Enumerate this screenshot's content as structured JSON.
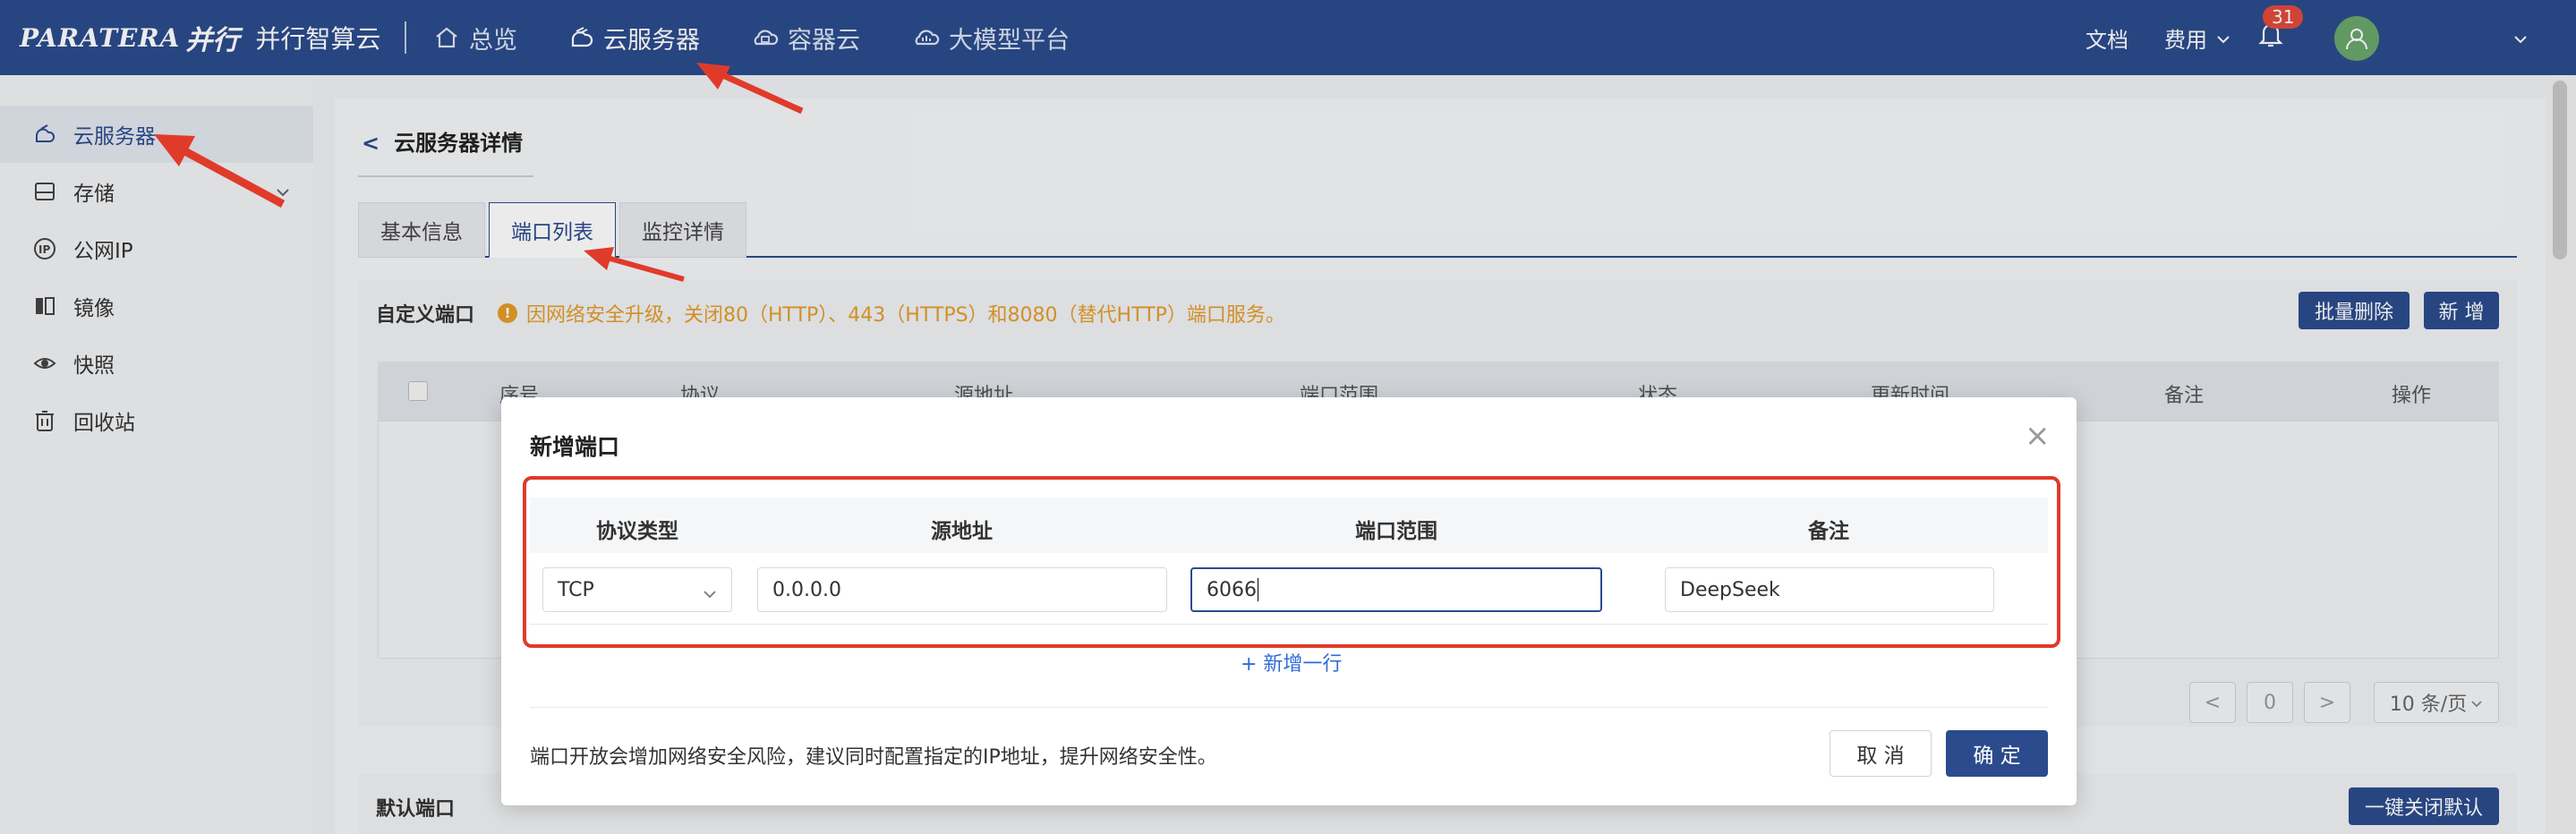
{
  "brand": {
    "name": "PARATERA",
    "cn": "并行",
    "subtitle": "并行智算云"
  },
  "topnav": [
    {
      "label": "总览",
      "icon": "home-icon"
    },
    {
      "label": "云服务器",
      "icon": "cloud-server-icon",
      "active": true
    },
    {
      "label": "容器云",
      "icon": "container-cloud-icon"
    },
    {
      "label": "大模型平台",
      "icon": "model-platform-icon"
    }
  ],
  "topright": {
    "docs": "文档",
    "fees": "费用",
    "notifications": "31"
  },
  "sidebar": {
    "items": [
      {
        "label": "云服务器",
        "icon": "cloud-server-icon",
        "active": true
      },
      {
        "label": "存储",
        "icon": "storage-icon",
        "expandable": true
      },
      {
        "label": "公网IP",
        "icon": "ip-icon"
      },
      {
        "label": "镜像",
        "icon": "image-icon"
      },
      {
        "label": "快照",
        "icon": "snapshot-icon"
      },
      {
        "label": "回收站",
        "icon": "recycle-bin-icon"
      }
    ]
  },
  "page": {
    "back": "<",
    "title": "云服务器详情",
    "tabs": [
      {
        "label": "基本信息"
      },
      {
        "label": "端口列表",
        "active": true
      },
      {
        "label": "监控详情"
      }
    ]
  },
  "custom_ports": {
    "title": "自定义端口",
    "notice": "因网络安全升级，关闭80（HTTP）、443（HTTPS）和8080（替代HTTP）端口服务。",
    "btn_batch_delete": "批量删除",
    "btn_add": "新 增",
    "columns": [
      "序号",
      "协议",
      "源地址",
      "端口范围",
      "状态",
      "更新时间",
      "备注",
      "操作"
    ],
    "pager": {
      "prev": "<",
      "page": "0",
      "next": ">",
      "size": "10 条/页"
    }
  },
  "default_ports": {
    "title": "默认端口",
    "btn_close_all": "一键关闭默认"
  },
  "modal": {
    "title": "新增端口",
    "close": "×",
    "columns": {
      "protocol": "协议类型",
      "source": "源地址",
      "port_range": "端口范围",
      "remark": "备注"
    },
    "row": {
      "protocol": "TCP",
      "source": "0.0.0.0",
      "port_range": "6066",
      "remark": "DeepSeek"
    },
    "add_row": "+ 新增一行",
    "hint": "端口开放会增加网络安全风险，建议同时配置指定的IP地址，提升网络安全性。",
    "cancel": "取 消",
    "confirm": "确 定"
  },
  "colors": {
    "primary": "#2b4b8c",
    "warning": "#e59c2a",
    "annotation": "#e03b2a",
    "link": "#2f6bd8"
  }
}
